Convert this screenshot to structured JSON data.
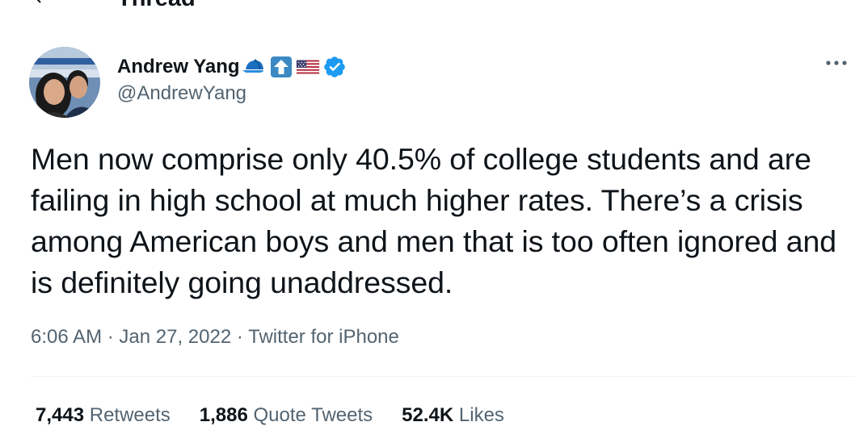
{
  "header": {
    "title": "Thread"
  },
  "tweet": {
    "author": {
      "display_name": "Andrew Yang",
      "handle": "@AndrewYang",
      "name_emojis": [
        "blue-cap-icon",
        "up-arrow-icon",
        "us-flag-icon"
      ],
      "verified": true
    },
    "text": "Men now comprise only 40.5% of college students and are failing in high school at much higher rates. There’s a crisis among American boys and men that is too often ignored and is definitely going unaddressed.",
    "time": "6:06 AM",
    "date": "Jan 27, 2022",
    "source": "Twitter for iPhone",
    "separator": "·"
  },
  "stats": {
    "retweets": {
      "count": "7,443",
      "label": "Retweets"
    },
    "quote_tweets": {
      "count": "1,886",
      "label": "Quote Tweets"
    },
    "likes": {
      "count": "52.4K",
      "label": "Likes"
    }
  },
  "colors": {
    "text_primary": "#0f1419",
    "text_secondary": "#536471",
    "verified_blue": "#1d9bf0",
    "divider": "#eff3f4"
  }
}
